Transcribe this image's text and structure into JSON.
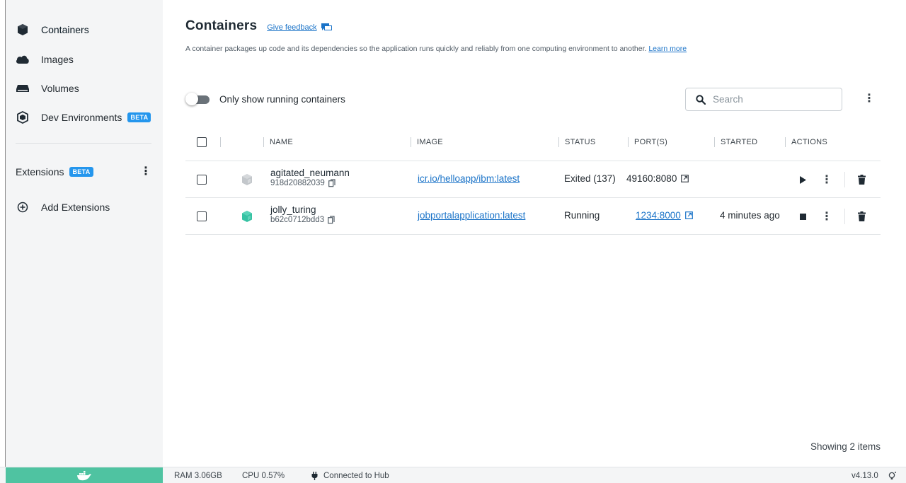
{
  "sidebar": {
    "items": [
      {
        "label": "Containers",
        "icon": "container-icon"
      },
      {
        "label": "Images",
        "icon": "cloud-icon"
      },
      {
        "label": "Volumes",
        "icon": "volume-icon"
      },
      {
        "label": "Dev Environments",
        "icon": "dev-environments-icon",
        "badge": "BETA"
      }
    ],
    "extensions": {
      "label": "Extensions",
      "badge": "BETA"
    },
    "add_extensions": "Add Extensions"
  },
  "header": {
    "title": "Containers",
    "feedback": "Give feedback",
    "description": "A container packages up code and its dependencies so the application runs quickly and reliably from one computing environment to another.",
    "learn_more": "Learn more"
  },
  "toolbar": {
    "toggle_label": "Only show running containers",
    "search_placeholder": "Search"
  },
  "table": {
    "columns": {
      "name": "NAME",
      "image": "IMAGE",
      "status": "STATUS",
      "ports": "PORT(S)",
      "started": "STARTED",
      "actions": "ACTIONS"
    },
    "rows": [
      {
        "name": "agitated_neumann",
        "id": "918d20882039",
        "image": "icr.io/helloapp/ibm:latest",
        "status": "Exited (137)",
        "port": "49160:8080",
        "started": "",
        "running": false
      },
      {
        "name": "jolly_turing",
        "id": "b62c0712bdd3",
        "image": "jobportalapplication:latest",
        "status": "Running",
        "port": "1234:8000",
        "started": "4 minutes ago",
        "running": true
      }
    ]
  },
  "showing": "Showing 2 items",
  "footer": {
    "ram": "RAM 3.06GB",
    "cpu": "CPU 0.57%",
    "hub": "Connected to Hub",
    "version": "v4.13.0"
  },
  "colors": {
    "accent": "#1a73c8",
    "badge": "#2496ed",
    "running": "#36c2a3",
    "stopped": "#c3c7cb",
    "footer_whale": "#4fc3a1"
  }
}
